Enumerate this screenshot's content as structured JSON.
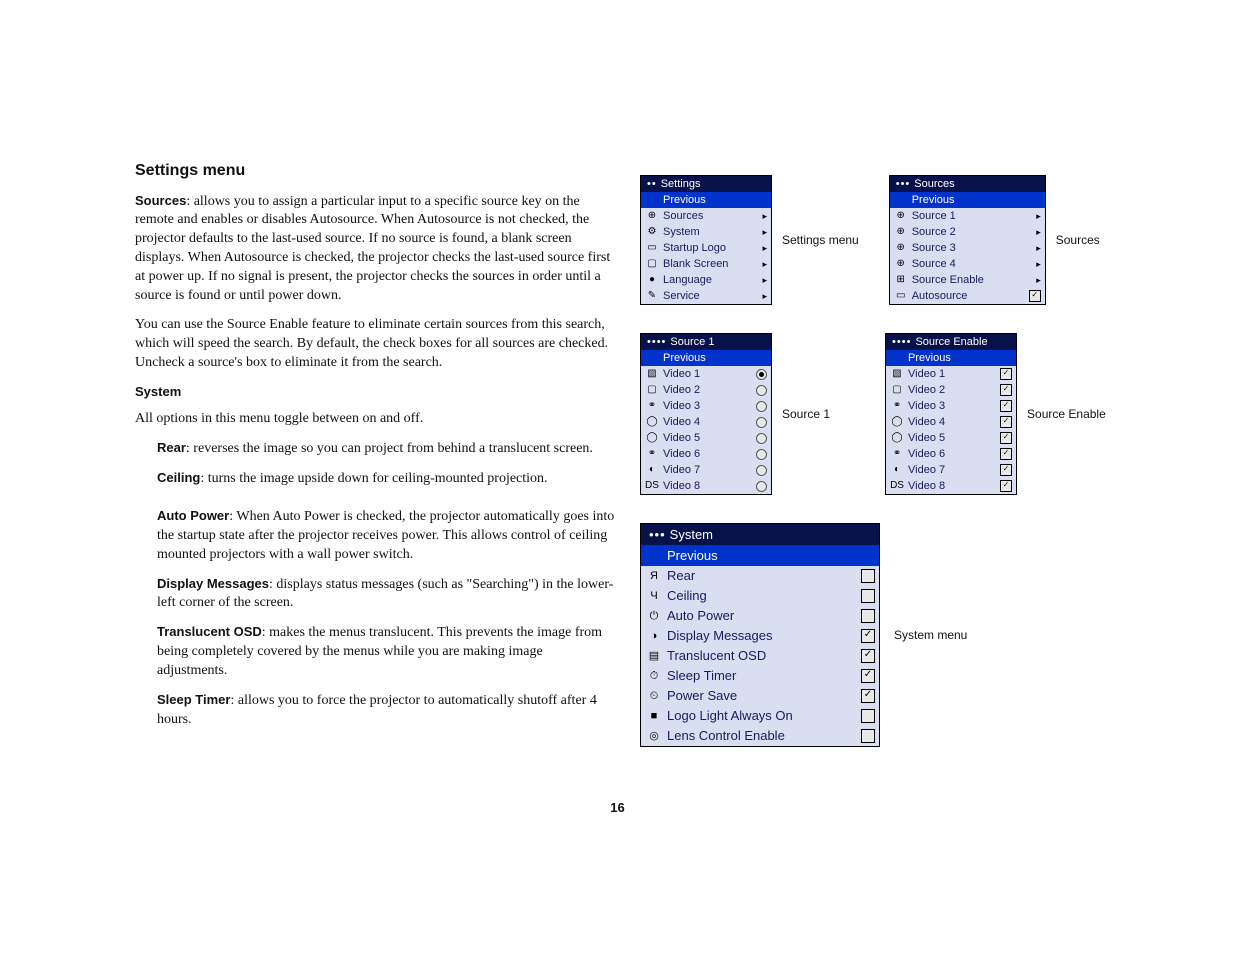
{
  "page_number": "16",
  "left": {
    "heading": "Settings menu",
    "p1a": "Sources",
    "p1b": ": allows you to assign a particular input to a specific source key on the remote and enables or disables Autosource. When Autosource is not checked, the projector defaults to the last-used source. If no source is found, a blank screen displays. When Autosource is checked, the projector checks the last-used source first at power up. If no signal is present, the projector checks the sources in order until a source is found or until power down.",
    "p2": "You can use the Source Enable feature to eliminate certain sources from this search, which will speed the search. By default, the check boxes for all sources are checked. Uncheck a source's box to eliminate it from the search.",
    "system_heading": "System",
    "p3": "All options in this menu toggle between on and off.",
    "rear_b": "Rear",
    "rear": ": reverses the image so you can project from behind a translucent screen.",
    "ceiling_b": "Ceiling",
    "ceiling": ": turns the image upside down for ceiling-mounted projection.",
    "auto_b": "Auto Power",
    "auto": ": When Auto Power is checked, the projector automatically goes into the startup state after the projector receives power. This allows control of ceiling mounted projectors with a wall power switch.",
    "disp_b": "Display Messages",
    "disp": ": displays status messages (such as \"Searching\") in the lower-left corner of the screen.",
    "trans_b": "Translucent OSD",
    "trans": ": makes the menus translucent. This prevents the image from being completely covered by the menus while you are making image adjustments.",
    "sleep_b": "Sleep Timer",
    "sleep": ": allows you to force the projector to automatically shutoff after 4 hours."
  },
  "captions": {
    "settings": "Settings menu",
    "sources": "Sources",
    "source1": "Source 1",
    "source_enable": "Source Enable",
    "system": "System menu"
  },
  "menus": {
    "settings": {
      "dots": "••",
      "title": "Settings",
      "previous": "Previous",
      "items": [
        {
          "icon": "⊕",
          "label": "Sources"
        },
        {
          "icon": "⚙",
          "label": "System"
        },
        {
          "icon": "▭",
          "label": "Startup Logo"
        },
        {
          "icon": "▢",
          "label": "Blank Screen"
        },
        {
          "icon": "●",
          "label": "Language"
        },
        {
          "icon": "✎",
          "label": "Service"
        }
      ]
    },
    "sources": {
      "dots": "•••",
      "title": "Sources",
      "previous": "Previous",
      "items": [
        {
          "icon": "⊕",
          "label": "Source 1"
        },
        {
          "icon": "⊕",
          "label": "Source 2"
        },
        {
          "icon": "⊕",
          "label": "Source 3"
        },
        {
          "icon": "⊕",
          "label": "Source 4"
        },
        {
          "icon": "⊞",
          "label": "Source Enable"
        },
        {
          "icon": "▭",
          "label": "Autosource",
          "checked": true
        }
      ]
    },
    "source1": {
      "dots": "••••",
      "title": "Source 1",
      "previous": "Previous",
      "items": [
        {
          "icon": "▧",
          "label": "Video 1",
          "selected": true
        },
        {
          "icon": "▢",
          "label": "Video 2"
        },
        {
          "icon": "⚭",
          "label": "Video 3"
        },
        {
          "icon": "◯",
          "label": "Video 4"
        },
        {
          "icon": "◯",
          "label": "Video 5"
        },
        {
          "icon": "⚭",
          "label": "Video 6"
        },
        {
          "icon": "◐",
          "label": "Video 7"
        },
        {
          "icon": "DS",
          "label": "Video 8"
        }
      ]
    },
    "source_enable": {
      "dots": "••••",
      "title": "Source Enable",
      "previous": "Previous",
      "items": [
        {
          "icon": "▧",
          "label": "Video 1",
          "checked": true
        },
        {
          "icon": "▢",
          "label": "Video 2",
          "checked": true
        },
        {
          "icon": "⚭",
          "label": "Video 3",
          "checked": true
        },
        {
          "icon": "◯",
          "label": "Video 4",
          "checked": true
        },
        {
          "icon": "◯",
          "label": "Video 5",
          "checked": true
        },
        {
          "icon": "⚭",
          "label": "Video 6",
          "checked": true
        },
        {
          "icon": "◐",
          "label": "Video 7",
          "checked": true
        },
        {
          "icon": "DS",
          "label": "Video 8",
          "checked": true
        }
      ]
    },
    "system": {
      "dots": "•••",
      "title": "System",
      "previous": "Previous",
      "items": [
        {
          "icon": "Я",
          "label": "Rear",
          "checked": false
        },
        {
          "icon": "Ч",
          "label": "Ceiling",
          "checked": false
        },
        {
          "icon": "⏻",
          "label": "Auto Power",
          "checked": false
        },
        {
          "icon": "◑",
          "label": "Display Messages",
          "checked": true
        },
        {
          "icon": "▤",
          "label": "Translucent OSD",
          "checked": true
        },
        {
          "icon": "⏱",
          "label": "Sleep Timer",
          "checked": true
        },
        {
          "icon": "⏲",
          "label": "Power Save",
          "checked": true
        },
        {
          "icon": "■",
          "label": "Logo Light Always On",
          "checked": false
        },
        {
          "icon": "◎",
          "label": "Lens Control Enable",
          "checked": false
        }
      ]
    }
  }
}
